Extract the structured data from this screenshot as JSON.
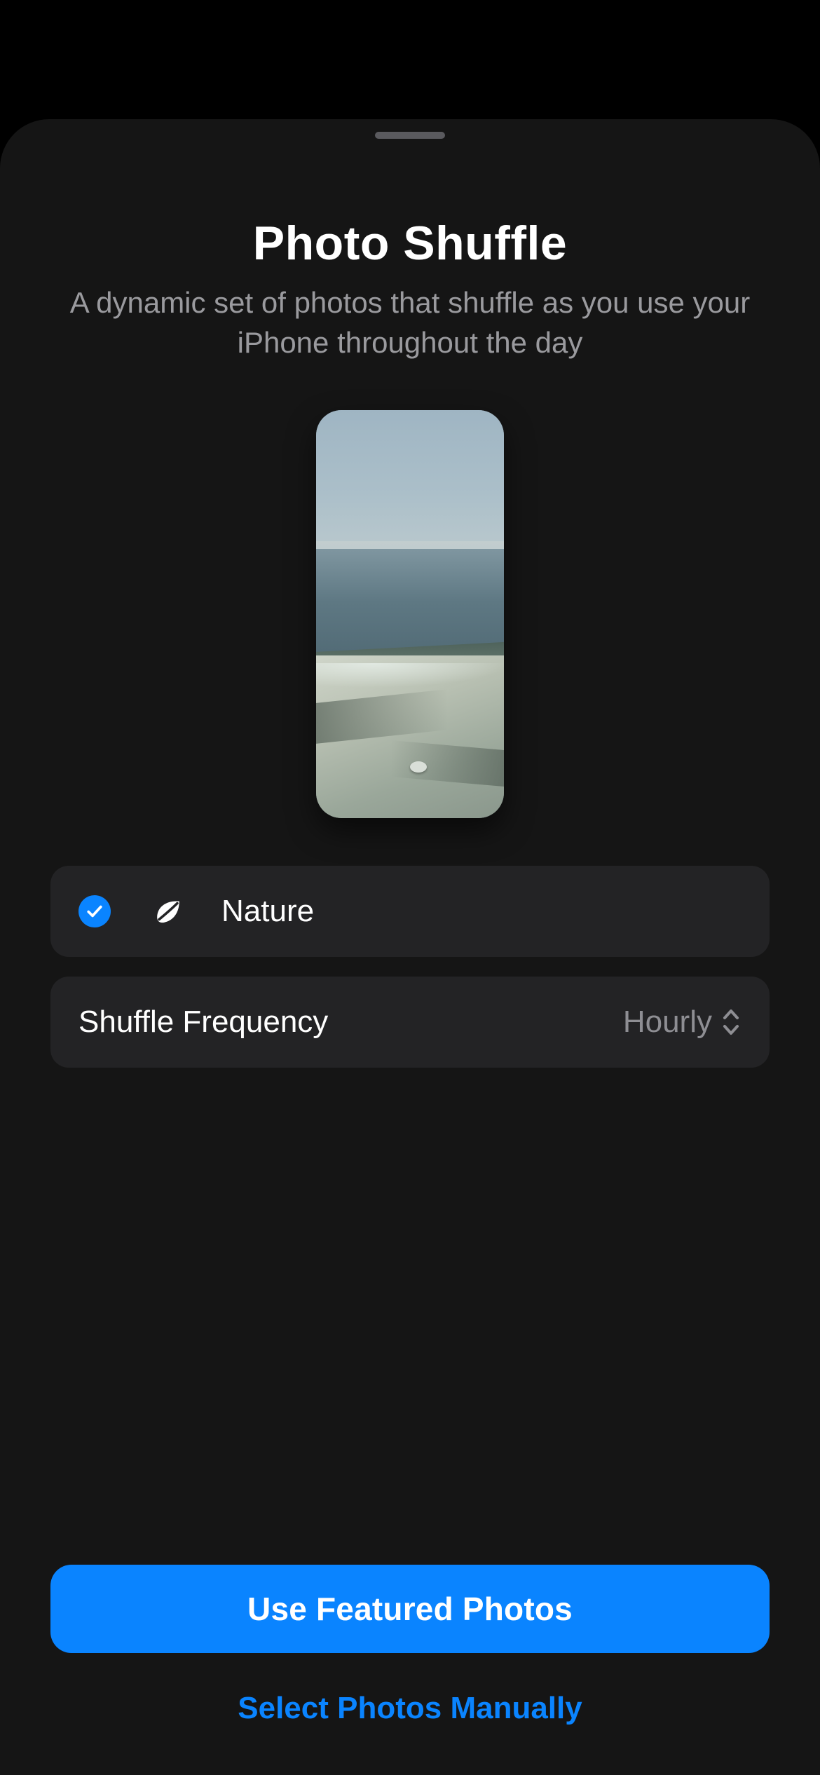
{
  "header": {
    "title": "Photo Shuffle",
    "subtitle": "A dynamic set of photos that shuffle as you use your iPhone throughout the day"
  },
  "category": {
    "selected": true,
    "icon": "leaf-icon",
    "label": "Nature"
  },
  "frequency": {
    "label": "Shuffle Frequency",
    "value": "Hourly"
  },
  "actions": {
    "primary": "Use Featured Photos",
    "secondary": "Select Photos Manually"
  }
}
